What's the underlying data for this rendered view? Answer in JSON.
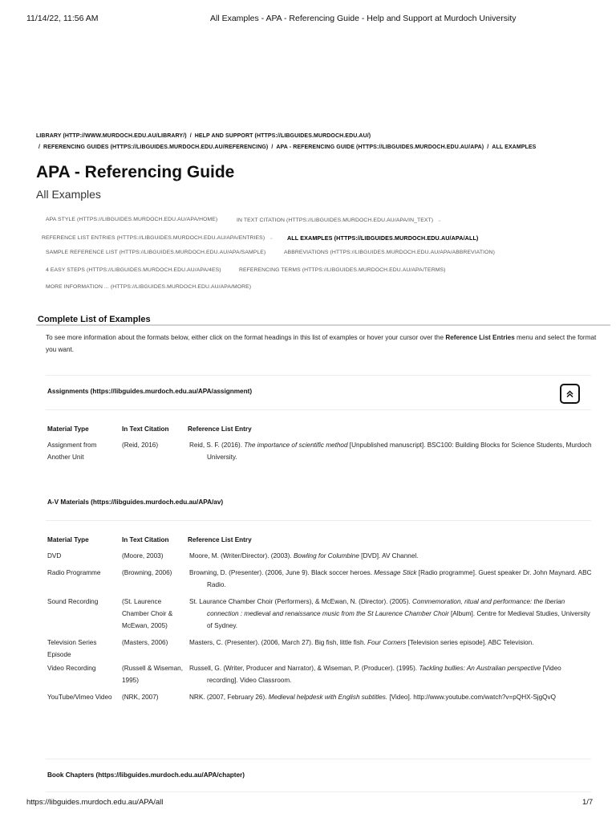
{
  "print_header": {
    "datetime": "11/14/22, 11:56 AM",
    "title": "All Examples - APA - Referencing Guide - Help and Support at Murdoch University"
  },
  "breadcrumb": {
    "items": [
      "LIBRARY (HTTP://WWW.MURDOCH.EDU.AU/LIBRARY/)",
      "HELP AND SUPPORT (HTTPS://LIBGUIDES.MURDOCH.EDU.AU/)",
      "REFERENCING GUIDES (HTTPS://LIBGUIDES.MURDOCH.EDU.AU/REFERENCING)",
      "APA - REFERENCING GUIDE (HTTPS://LIBGUIDES.MURDOCH.EDU.AU/APA)",
      "ALL EXAMPLES"
    ],
    "separator": "/"
  },
  "page": {
    "title": "APA - Referencing Guide",
    "subtitle": "All Examples"
  },
  "guide_nav": {
    "caret": "⌄",
    "items": [
      {
        "label": "APA STYLE (HTTPS://LIBGUIDES.MURDOCH.EDU.AU/APA/HOME)",
        "active": false,
        "has_dropdown": false
      },
      {
        "label": "IN TEXT CITATION (HTTPS://LIBGUIDES.MURDOCH.EDU.AU/APA/IN_TEXT)",
        "active": false,
        "has_dropdown": true
      },
      {
        "label": "REFERENCE LIST ENTRIES (HTTPS://LIBGUIDES.MURDOCH.EDU.AU/APA/ENTRIES)",
        "active": false,
        "has_dropdown": true
      },
      {
        "label": "ALL EXAMPLES (HTTPS://LIBGUIDES.MURDOCH.EDU.AU/APA/ALL)",
        "active": true,
        "has_dropdown": false
      },
      {
        "label": "SAMPLE REFERENCE LIST (HTTPS://LIBGUIDES.MURDOCH.EDU.AU/APA/SAMPLE)",
        "active": false,
        "has_dropdown": false
      },
      {
        "label": "ABBREVIATIONS (HTTPS://LIBGUIDES.MURDOCH.EDU.AU/APA/ABBREVIATION)",
        "active": false,
        "has_dropdown": false
      },
      {
        "label": "4 EASY STEPS (HTTPS://LIBGUIDES.MURDOCH.EDU.AU/APA/4ES)",
        "active": false,
        "has_dropdown": false
      },
      {
        "label": "REFERENCING TERMS (HTTPS://LIBGUIDES.MURDOCH.EDU.AU/APA/TERMS)",
        "active": false,
        "has_dropdown": false
      },
      {
        "label": "MORE INFORMATION ... (HTTPS://LIBGUIDES.MURDOCH.EDU.AU/APA/MORE)",
        "active": false,
        "has_dropdown": false
      }
    ]
  },
  "content": {
    "heading": "Complete List of Examples",
    "intro_before": "To see more information about the formats below, either click on the format headings in this list of examples or hover your cursor over the ",
    "intro_bold": "Reference List Entries",
    "intro_after": " menu and select the format you want.",
    "back_to_top_icon": "double-chevron-up-icon",
    "table_headers": [
      "Material Type",
      "In Text Citation",
      "Reference List Entry"
    ],
    "groups": [
      {
        "title": "Assignments (https://libguides.murdoch.edu.au/APA/assignment)",
        "rows": [
          {
            "type": "Assignment from Another Unit",
            "citation": "(Reid, 2016)",
            "entry": [
              {
                "t": "Reid, S. F. (2016). ",
                "i": false
              },
              {
                "t": "The importance of scientific method",
                "i": true
              },
              {
                "t": " [Unpublished manuscript]. BSC100: Building Blocks for Science Students, Murdoch University.",
                "i": false
              }
            ]
          }
        ]
      },
      {
        "title": "A-V Materials (https://libguides.murdoch.edu.au/APA/av)",
        "rows": [
          {
            "type": "DVD",
            "citation": "(Moore, 2003)",
            "entry": [
              {
                "t": "Moore, M. (Writer/Director). (2003). ",
                "i": false
              },
              {
                "t": "Bowling for Columbine",
                "i": true
              },
              {
                "t": " [DVD]. AV Channel.",
                "i": false
              }
            ]
          },
          {
            "type": "Radio Programme",
            "citation": "(Browning, 2006)",
            "entry": [
              {
                "t": "Browning, D. (Presenter). (2006, June 9). Black soccer heroes. ",
                "i": false
              },
              {
                "t": "Message Stick",
                "i": true
              },
              {
                "t": " [Radio programme]. Guest speaker Dr. John Maynard. ABC Radio.",
                "i": false
              }
            ]
          },
          {
            "type": "Sound Recording",
            "citation": "(St. Laurence Chamber Choir & McEwan, 2005)",
            "entry": [
              {
                "t": "St. Laurance Chamber Choir (Performers), & McEwan, N. (Director). (2005). ",
                "i": false
              },
              {
                "t": "Commemoration, ritual and performance: the Iberian connection : medieval and renaissance music from the St Laurence Chamber Choir",
                "i": true
              },
              {
                "t": " [Album]. Centre for Medieval Studies, University of Sydney.",
                "i": false
              }
            ]
          },
          {
            "type": "Television Series Episode",
            "citation": "(Masters, 2006)",
            "entry": [
              {
                "t": "Masters, C. (Presenter). (2006, March 27). Big fish, little fish. ",
                "i": false
              },
              {
                "t": "Four Corners",
                "i": true
              },
              {
                "t": " [Television series episode]. ABC Television.",
                "i": false
              }
            ]
          },
          {
            "type": "Video Recording",
            "citation": "(Russell & Wiseman, 1995)",
            "entry": [
              {
                "t": "Russell, G. (Writer, Producer and Narrator), & Wiseman, P. (Producer). (1995). ",
                "i": false
              },
              {
                "t": "Tackling bullies: An Australian perspective",
                "i": true
              },
              {
                "t": " [Video recording]. Video Classroom.",
                "i": false
              }
            ]
          },
          {
            "type": "YouTube/Vimeo Video",
            "citation": "(NRK, 2007)",
            "entry": [
              {
                "t": "NRK. (2007, February 26). ",
                "i": false
              },
              {
                "t": "Medieval helpdesk with English subtitles.",
                "i": true
              },
              {
                "t": " [Video]. http://www.youtube.com/watch?v=pQHX-SjgQvQ",
                "i": false
              }
            ]
          }
        ]
      },
      {
        "title": "Book Chapters (https://libguides.murdoch.edu.au/APA/chapter)",
        "rows": []
      }
    ]
  },
  "print_footer": {
    "url": "https://libguides.murdoch.edu.au/APA/all",
    "page": "1/7"
  }
}
